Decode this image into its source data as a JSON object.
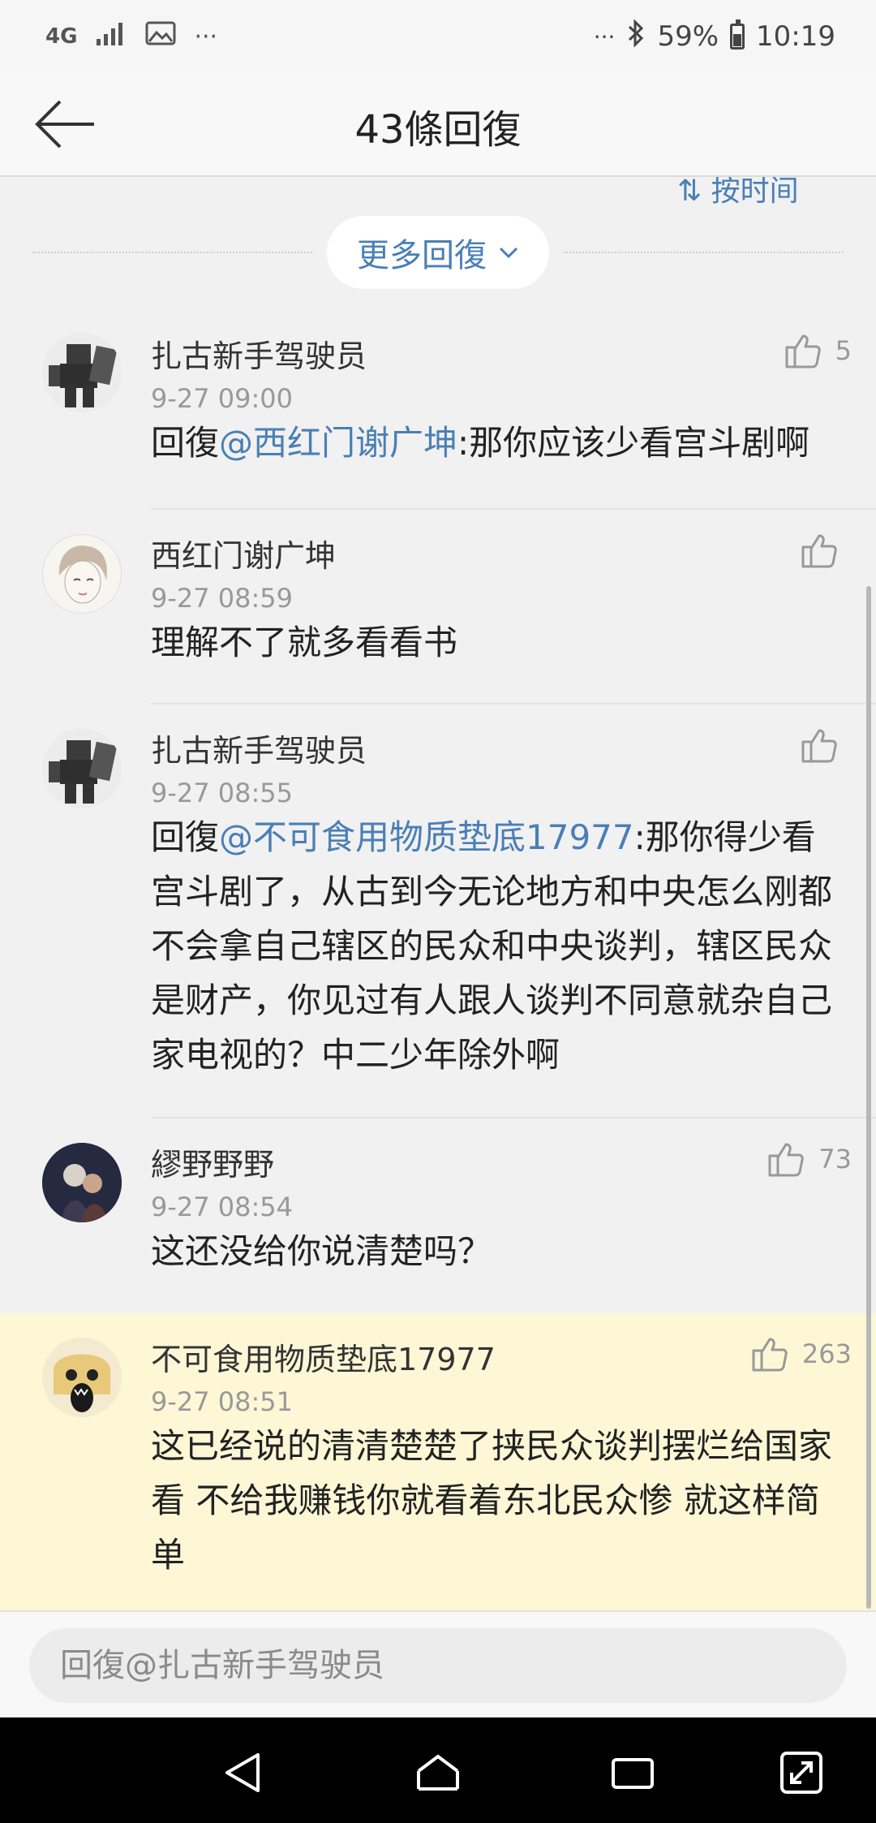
{
  "status_bar": {
    "network": "4G",
    "more_left": "···",
    "more_right": "···",
    "battery": "59%",
    "time": "10:19"
  },
  "header": {
    "title": "43條回復"
  },
  "sort_label": "⇅ 按时间",
  "more_replies": {
    "label": "更多回復"
  },
  "comments": [
    {
      "name": "扎古新手驾驶员",
      "time": "9-27 09:00",
      "prefix": "回復",
      "mention": "@西红门谢广坤",
      "text": ":那你应该少看宫斗剧啊",
      "likes": "5"
    },
    {
      "name": "西红门谢广坤",
      "time": "9-27 08:59",
      "prefix": "",
      "mention": "",
      "text": "理解不了就多看看书",
      "likes": ""
    },
    {
      "name": "扎古新手驾驶员",
      "time": "9-27 08:55",
      "prefix": "回復",
      "mention": "@不可食用物质垫底17977",
      "text": ":那你得少看宫斗剧了，从古到今无论地方和中央怎么刚都不会拿自己辖区的民众和中央谈判，辖区民众是财产，你见过有人跟人谈判不同意就杂自己家电视的？中二少年除外啊",
      "likes": ""
    },
    {
      "name": "繆野野野",
      "time": "9-27 08:54",
      "prefix": "",
      "mention": "",
      "text": "这还没给你说清楚吗？",
      "likes": "73"
    },
    {
      "name": "不可食用物质垫底17977",
      "time": "9-27 08:51",
      "prefix": "",
      "mention": "",
      "text": "这已经说的清清楚楚了挟民众谈判摆烂给国家看  不给我赚钱你就看着东北民众惨  就这样简单",
      "likes": "263"
    }
  ],
  "reply_input": {
    "placeholder": "回復@扎古新手驾驶员"
  },
  "colors": {
    "accent": "#4a7fb5",
    "highlight": "#fdf7d6",
    "background": "#f1f1f1"
  }
}
